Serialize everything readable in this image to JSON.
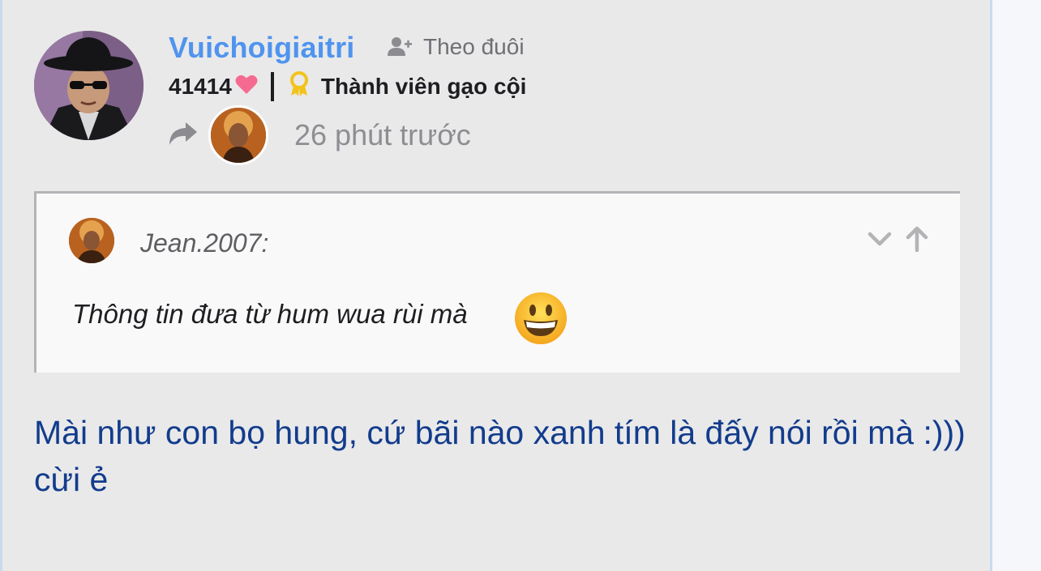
{
  "post": {
    "author": {
      "username": "Vuichoigiaitri",
      "follow_label": "Theo đuôi",
      "score": "41414",
      "rank": "Thành viên gạo cội"
    },
    "time_ago": "26 phút trước",
    "quote": {
      "author": "Jean.2007:",
      "text": "Thông tin đưa từ hum wua rùi mà"
    },
    "body": "Mài như con bọ hung, cứ bãi nào xanh tím là đấy nói rồi mà :))) cừi ẻ"
  },
  "colors": {
    "username": "#4f94ee",
    "body_text": "#123c8c",
    "heart": "#f56b8f",
    "medal": "#f3c31b",
    "background": "#e9e9ea",
    "quote_bg": "#f9f9f9"
  },
  "icons": [
    "follow-user-icon",
    "heart-icon",
    "medal-icon",
    "share-icon",
    "chevron-down-icon",
    "arrow-up-icon",
    "grinning-emoji-icon"
  ]
}
